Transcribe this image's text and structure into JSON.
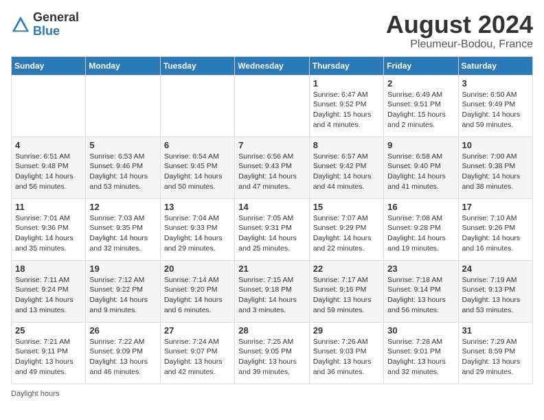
{
  "header": {
    "logo_general": "General",
    "logo_blue": "Blue",
    "main_title": "August 2024",
    "subtitle": "Pleumeur-Bodou, France"
  },
  "weekdays": [
    "Sunday",
    "Monday",
    "Tuesday",
    "Wednesday",
    "Thursday",
    "Friday",
    "Saturday"
  ],
  "weeks": [
    [
      {
        "num": "",
        "info": ""
      },
      {
        "num": "",
        "info": ""
      },
      {
        "num": "",
        "info": ""
      },
      {
        "num": "",
        "info": ""
      },
      {
        "num": "1",
        "info": "Sunrise: 6:47 AM\nSunset: 9:52 PM\nDaylight: 15 hours\nand 4 minutes."
      },
      {
        "num": "2",
        "info": "Sunrise: 6:49 AM\nSunset: 9:51 PM\nDaylight: 15 hours\nand 2 minutes."
      },
      {
        "num": "3",
        "info": "Sunrise: 6:50 AM\nSunset: 9:49 PM\nDaylight: 14 hours\nand 59 minutes."
      }
    ],
    [
      {
        "num": "4",
        "info": "Sunrise: 6:51 AM\nSunset: 9:48 PM\nDaylight: 14 hours\nand 56 minutes."
      },
      {
        "num": "5",
        "info": "Sunrise: 6:53 AM\nSunset: 9:46 PM\nDaylight: 14 hours\nand 53 minutes."
      },
      {
        "num": "6",
        "info": "Sunrise: 6:54 AM\nSunset: 9:45 PM\nDaylight: 14 hours\nand 50 minutes."
      },
      {
        "num": "7",
        "info": "Sunrise: 6:56 AM\nSunset: 9:43 PM\nDaylight: 14 hours\nand 47 minutes."
      },
      {
        "num": "8",
        "info": "Sunrise: 6:57 AM\nSunset: 9:42 PM\nDaylight: 14 hours\nand 44 minutes."
      },
      {
        "num": "9",
        "info": "Sunrise: 6:58 AM\nSunset: 9:40 PM\nDaylight: 14 hours\nand 41 minutes."
      },
      {
        "num": "10",
        "info": "Sunrise: 7:00 AM\nSunset: 9:38 PM\nDaylight: 14 hours\nand 38 minutes."
      }
    ],
    [
      {
        "num": "11",
        "info": "Sunrise: 7:01 AM\nSunset: 9:36 PM\nDaylight: 14 hours\nand 35 minutes."
      },
      {
        "num": "12",
        "info": "Sunrise: 7:03 AM\nSunset: 9:35 PM\nDaylight: 14 hours\nand 32 minutes."
      },
      {
        "num": "13",
        "info": "Sunrise: 7:04 AM\nSunset: 9:33 PM\nDaylight: 14 hours\nand 29 minutes."
      },
      {
        "num": "14",
        "info": "Sunrise: 7:05 AM\nSunset: 9:31 PM\nDaylight: 14 hours\nand 25 minutes."
      },
      {
        "num": "15",
        "info": "Sunrise: 7:07 AM\nSunset: 9:29 PM\nDaylight: 14 hours\nand 22 minutes."
      },
      {
        "num": "16",
        "info": "Sunrise: 7:08 AM\nSunset: 9:28 PM\nDaylight: 14 hours\nand 19 minutes."
      },
      {
        "num": "17",
        "info": "Sunrise: 7:10 AM\nSunset: 9:26 PM\nDaylight: 14 hours\nand 16 minutes."
      }
    ],
    [
      {
        "num": "18",
        "info": "Sunrise: 7:11 AM\nSunset: 9:24 PM\nDaylight: 14 hours\nand 13 minutes."
      },
      {
        "num": "19",
        "info": "Sunrise: 7:12 AM\nSunset: 9:22 PM\nDaylight: 14 hours\nand 9 minutes."
      },
      {
        "num": "20",
        "info": "Sunrise: 7:14 AM\nSunset: 9:20 PM\nDaylight: 14 hours\nand 6 minutes."
      },
      {
        "num": "21",
        "info": "Sunrise: 7:15 AM\nSunset: 9:18 PM\nDaylight: 14 hours\nand 3 minutes."
      },
      {
        "num": "22",
        "info": "Sunrise: 7:17 AM\nSunset: 9:16 PM\nDaylight: 13 hours\nand 59 minutes."
      },
      {
        "num": "23",
        "info": "Sunrise: 7:18 AM\nSunset: 9:14 PM\nDaylight: 13 hours\nand 56 minutes."
      },
      {
        "num": "24",
        "info": "Sunrise: 7:19 AM\nSunset: 9:13 PM\nDaylight: 13 hours\nand 53 minutes."
      }
    ],
    [
      {
        "num": "25",
        "info": "Sunrise: 7:21 AM\nSunset: 9:11 PM\nDaylight: 13 hours\nand 49 minutes."
      },
      {
        "num": "26",
        "info": "Sunrise: 7:22 AM\nSunset: 9:09 PM\nDaylight: 13 hours\nand 46 minutes."
      },
      {
        "num": "27",
        "info": "Sunrise: 7:24 AM\nSunset: 9:07 PM\nDaylight: 13 hours\nand 42 minutes."
      },
      {
        "num": "28",
        "info": "Sunrise: 7:25 AM\nSunset: 9:05 PM\nDaylight: 13 hours\nand 39 minutes."
      },
      {
        "num": "29",
        "info": "Sunrise: 7:26 AM\nSunset: 9:03 PM\nDaylight: 13 hours\nand 36 minutes."
      },
      {
        "num": "30",
        "info": "Sunrise: 7:28 AM\nSunset: 9:01 PM\nDaylight: 13 hours\nand 32 minutes."
      },
      {
        "num": "31",
        "info": "Sunrise: 7:29 AM\nSunset: 8:59 PM\nDaylight: 13 hours\nand 29 minutes."
      }
    ]
  ],
  "footer": "Daylight hours"
}
